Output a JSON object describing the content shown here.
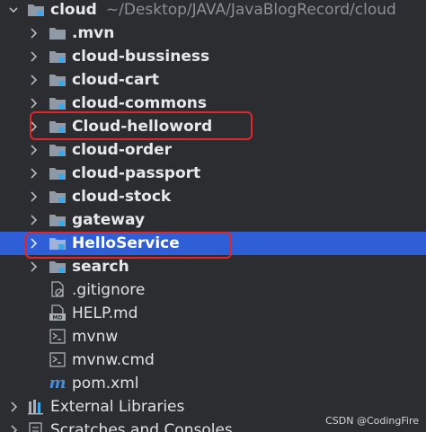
{
  "project": {
    "name": "cloud",
    "path": "~/Desktop/JAVA/JavaBlogRecord/cloud"
  },
  "items": [
    {
      "label": ".mvn",
      "kind": "folder"
    },
    {
      "label": "cloud-bussiness",
      "kind": "module"
    },
    {
      "label": "cloud-cart",
      "kind": "module"
    },
    {
      "label": "cloud-commons",
      "kind": "module"
    },
    {
      "label": "Cloud-helloword",
      "kind": "module"
    },
    {
      "label": "cloud-order",
      "kind": "module"
    },
    {
      "label": "cloud-passport",
      "kind": "module"
    },
    {
      "label": "cloud-stock",
      "kind": "module"
    },
    {
      "label": "gateway",
      "kind": "module"
    },
    {
      "label": "HelloService",
      "kind": "module"
    },
    {
      "label": "search",
      "kind": "module"
    }
  ],
  "files": [
    {
      "label": ".gitignore",
      "icon": "gitignore-file-icon"
    },
    {
      "label": "HELP.md",
      "icon": "markdown-file-icon"
    },
    {
      "label": "mvnw",
      "icon": "script-file-icon"
    },
    {
      "label": "mvnw.cmd",
      "icon": "script-file-icon"
    },
    {
      "label": "pom.xml",
      "icon": "maven-file-icon"
    }
  ],
  "external": {
    "label": "External Libraries"
  },
  "scratches": {
    "label": "Scratches and Consoles"
  },
  "selected_item": "HelloService",
  "highlighted_items": [
    "Cloud-helloword",
    "HelloService"
  ],
  "watermark": "CSDN @CodingFire",
  "colors": {
    "background": "#2b2d30",
    "selection": "#2f5fd6",
    "highlight_border": "#e0262b",
    "folder": "#8f9aa6",
    "module_badge": "#3fa6e8"
  }
}
